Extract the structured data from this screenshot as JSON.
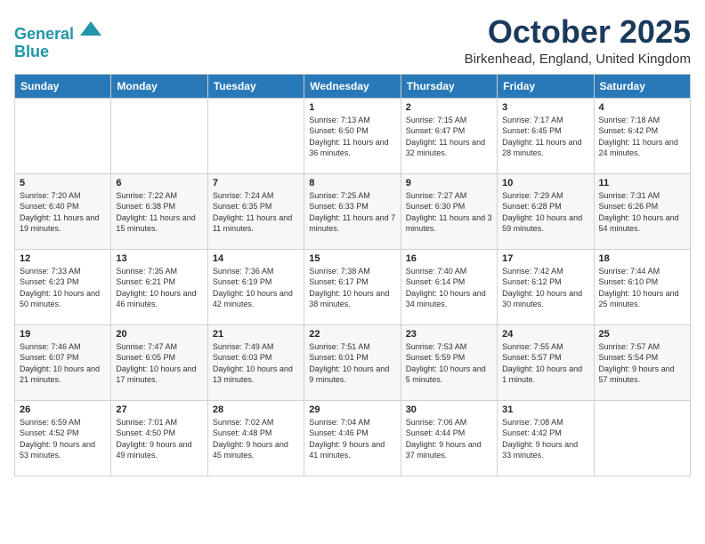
{
  "header": {
    "logo_line1": "General",
    "logo_line2": "Blue",
    "month": "October 2025",
    "location": "Birkenhead, England, United Kingdom"
  },
  "weekdays": [
    "Sunday",
    "Monday",
    "Tuesday",
    "Wednesday",
    "Thursday",
    "Friday",
    "Saturday"
  ],
  "weeks": [
    [
      {
        "day": "",
        "sunrise": "",
        "sunset": "",
        "daylight": ""
      },
      {
        "day": "",
        "sunrise": "",
        "sunset": "",
        "daylight": ""
      },
      {
        "day": "",
        "sunrise": "",
        "sunset": "",
        "daylight": ""
      },
      {
        "day": "1",
        "sunrise": "7:13 AM",
        "sunset": "6:50 PM",
        "daylight": "11 hours and 36 minutes."
      },
      {
        "day": "2",
        "sunrise": "7:15 AM",
        "sunset": "6:47 PM",
        "daylight": "11 hours and 32 minutes."
      },
      {
        "day": "3",
        "sunrise": "7:17 AM",
        "sunset": "6:45 PM",
        "daylight": "11 hours and 28 minutes."
      },
      {
        "day": "4",
        "sunrise": "7:18 AM",
        "sunset": "6:42 PM",
        "daylight": "11 hours and 24 minutes."
      }
    ],
    [
      {
        "day": "5",
        "sunrise": "7:20 AM",
        "sunset": "6:40 PM",
        "daylight": "11 hours and 19 minutes."
      },
      {
        "day": "6",
        "sunrise": "7:22 AM",
        "sunset": "6:38 PM",
        "daylight": "11 hours and 15 minutes."
      },
      {
        "day": "7",
        "sunrise": "7:24 AM",
        "sunset": "6:35 PM",
        "daylight": "11 hours and 11 minutes."
      },
      {
        "day": "8",
        "sunrise": "7:25 AM",
        "sunset": "6:33 PM",
        "daylight": "11 hours and 7 minutes."
      },
      {
        "day": "9",
        "sunrise": "7:27 AM",
        "sunset": "6:30 PM",
        "daylight": "11 hours and 3 minutes."
      },
      {
        "day": "10",
        "sunrise": "7:29 AM",
        "sunset": "6:28 PM",
        "daylight": "10 hours and 59 minutes."
      },
      {
        "day": "11",
        "sunrise": "7:31 AM",
        "sunset": "6:26 PM",
        "daylight": "10 hours and 54 minutes."
      }
    ],
    [
      {
        "day": "12",
        "sunrise": "7:33 AM",
        "sunset": "6:23 PM",
        "daylight": "10 hours and 50 minutes."
      },
      {
        "day": "13",
        "sunrise": "7:35 AM",
        "sunset": "6:21 PM",
        "daylight": "10 hours and 46 minutes."
      },
      {
        "day": "14",
        "sunrise": "7:36 AM",
        "sunset": "6:19 PM",
        "daylight": "10 hours and 42 minutes."
      },
      {
        "day": "15",
        "sunrise": "7:38 AM",
        "sunset": "6:17 PM",
        "daylight": "10 hours and 38 minutes."
      },
      {
        "day": "16",
        "sunrise": "7:40 AM",
        "sunset": "6:14 PM",
        "daylight": "10 hours and 34 minutes."
      },
      {
        "day": "17",
        "sunrise": "7:42 AM",
        "sunset": "6:12 PM",
        "daylight": "10 hours and 30 minutes."
      },
      {
        "day": "18",
        "sunrise": "7:44 AM",
        "sunset": "6:10 PM",
        "daylight": "10 hours and 25 minutes."
      }
    ],
    [
      {
        "day": "19",
        "sunrise": "7:46 AM",
        "sunset": "6:07 PM",
        "daylight": "10 hours and 21 minutes."
      },
      {
        "day": "20",
        "sunrise": "7:47 AM",
        "sunset": "6:05 PM",
        "daylight": "10 hours and 17 minutes."
      },
      {
        "day": "21",
        "sunrise": "7:49 AM",
        "sunset": "6:03 PM",
        "daylight": "10 hours and 13 minutes."
      },
      {
        "day": "22",
        "sunrise": "7:51 AM",
        "sunset": "6:01 PM",
        "daylight": "10 hours and 9 minutes."
      },
      {
        "day": "23",
        "sunrise": "7:53 AM",
        "sunset": "5:59 PM",
        "daylight": "10 hours and 5 minutes."
      },
      {
        "day": "24",
        "sunrise": "7:55 AM",
        "sunset": "5:57 PM",
        "daylight": "10 hours and 1 minute."
      },
      {
        "day": "25",
        "sunrise": "7:57 AM",
        "sunset": "5:54 PM",
        "daylight": "9 hours and 57 minutes."
      }
    ],
    [
      {
        "day": "26",
        "sunrise": "6:59 AM",
        "sunset": "4:52 PM",
        "daylight": "9 hours and 53 minutes."
      },
      {
        "day": "27",
        "sunrise": "7:01 AM",
        "sunset": "4:50 PM",
        "daylight": "9 hours and 49 minutes."
      },
      {
        "day": "28",
        "sunrise": "7:02 AM",
        "sunset": "4:48 PM",
        "daylight": "9 hours and 45 minutes."
      },
      {
        "day": "29",
        "sunrise": "7:04 AM",
        "sunset": "4:46 PM",
        "daylight": "9 hours and 41 minutes."
      },
      {
        "day": "30",
        "sunrise": "7:06 AM",
        "sunset": "4:44 PM",
        "daylight": "9 hours and 37 minutes."
      },
      {
        "day": "31",
        "sunrise": "7:08 AM",
        "sunset": "4:42 PM",
        "daylight": "9 hours and 33 minutes."
      },
      {
        "day": "",
        "sunrise": "",
        "sunset": "",
        "daylight": ""
      }
    ]
  ]
}
